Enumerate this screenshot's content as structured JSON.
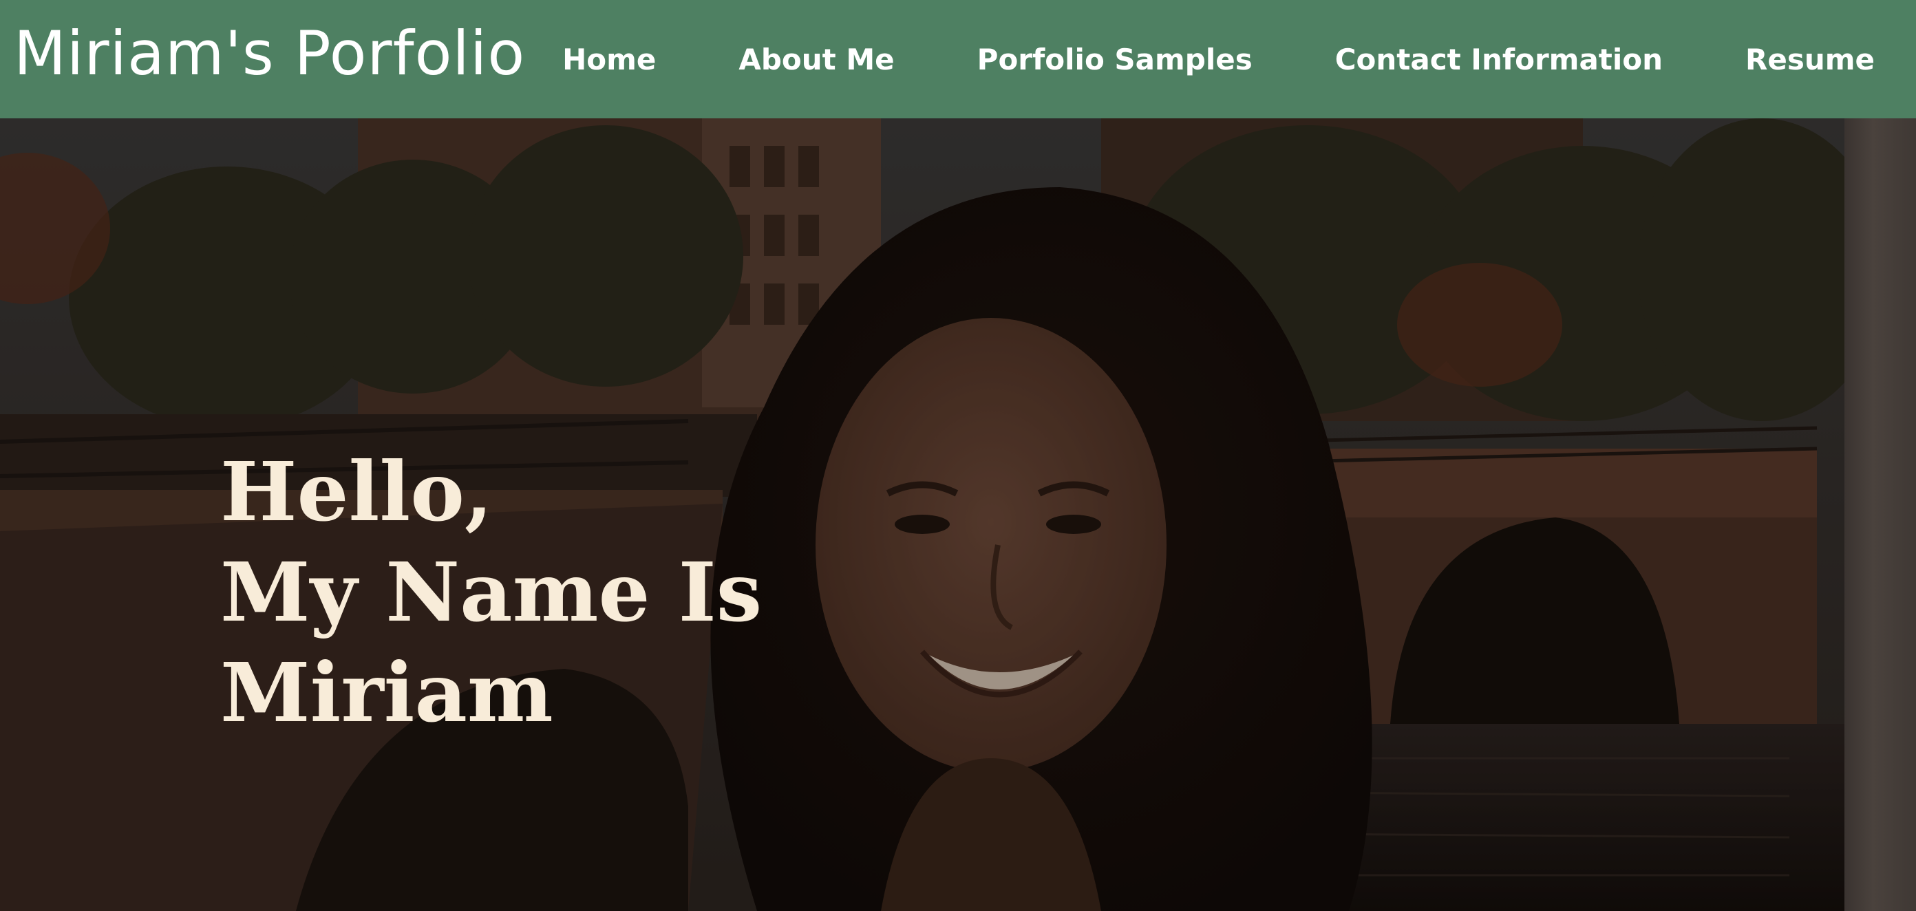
{
  "header": {
    "brand": "Miriam's Porfolio",
    "nav": [
      {
        "label": "Home"
      },
      {
        "label": "About Me"
      },
      {
        "label": "Porfolio Samples"
      },
      {
        "label": "Contact Information"
      },
      {
        "label": "Resume"
      }
    ]
  },
  "hero": {
    "heading_lines": [
      "Hello,",
      "My Name Is",
      "Miriam"
    ]
  },
  "colors": {
    "nav_background": "#4e8062",
    "nav_text": "#ffffff",
    "hero_text": "#f8ecd9"
  }
}
